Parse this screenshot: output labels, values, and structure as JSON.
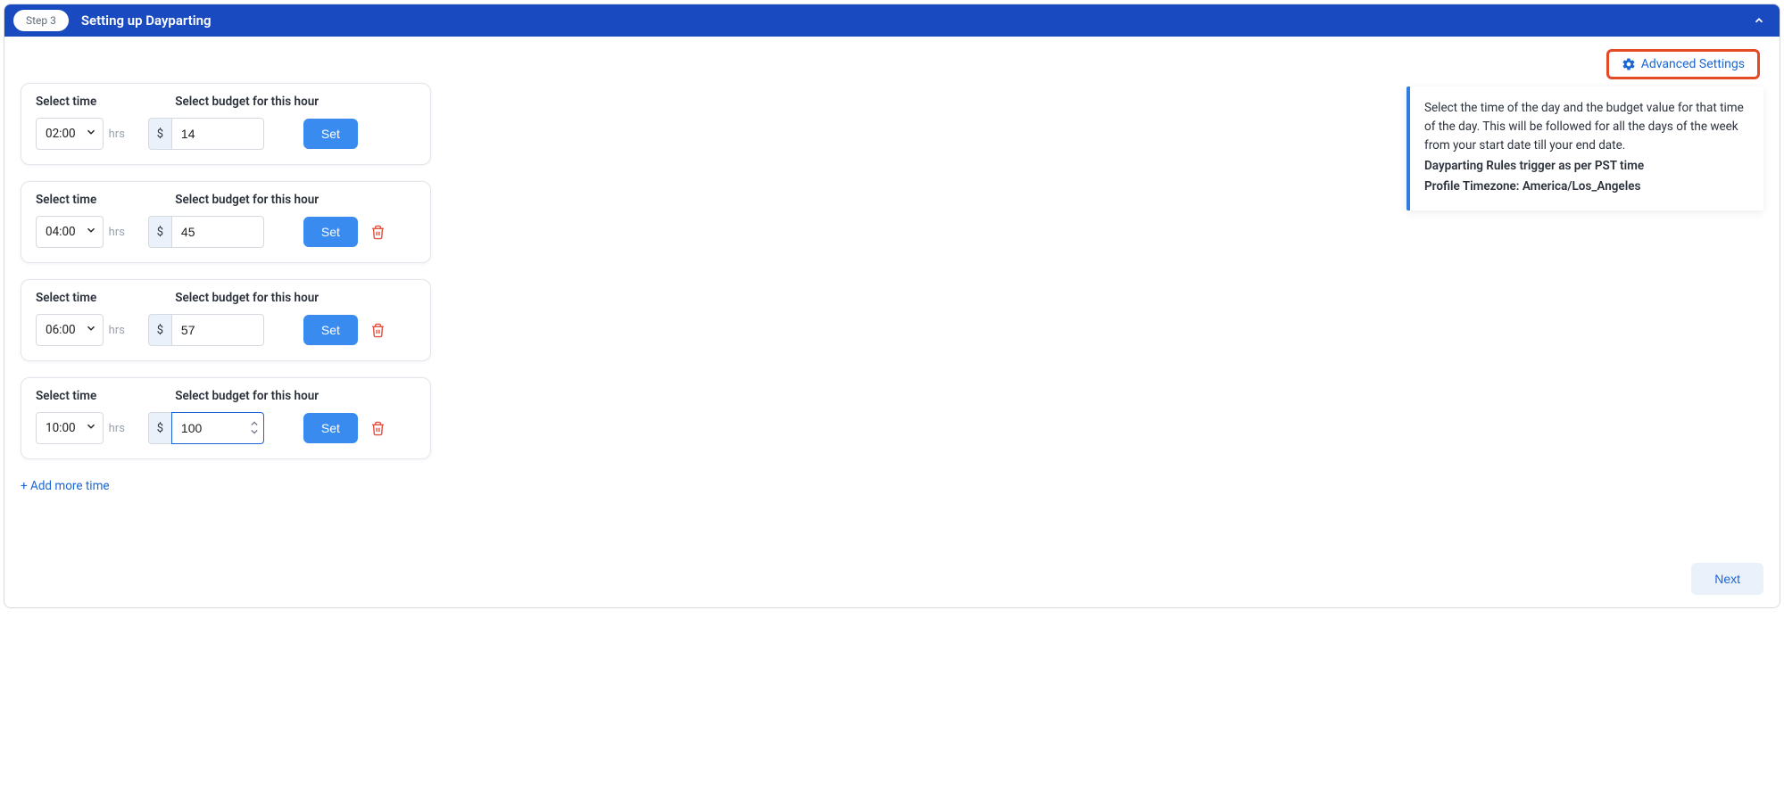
{
  "header": {
    "step_label": "Step 3",
    "title": "Setting up Dayparting"
  },
  "advanced_settings_label": "Advanced Settings",
  "labels": {
    "select_time": "Select time",
    "select_budget": "Select budget for this hour",
    "hrs": "hrs",
    "currency": "$",
    "set": "Set"
  },
  "rows": [
    {
      "time": "02:00",
      "budget": "14",
      "show_delete": false,
      "focused": false,
      "show_stepper": false
    },
    {
      "time": "04:00",
      "budget": "45",
      "show_delete": true,
      "focused": false,
      "show_stepper": false
    },
    {
      "time": "06:00",
      "budget": "57",
      "show_delete": true,
      "focused": false,
      "show_stepper": false
    },
    {
      "time": "10:00",
      "budget": "100",
      "show_delete": true,
      "focused": true,
      "show_stepper": true
    }
  ],
  "add_more_label": "+ Add more time",
  "info": {
    "text": "Select the time of the day and the budget value for that time of the day. This will be followed for all the days of the week from your start date till your end date.",
    "bold1": "Dayparting Rules trigger as per PST time",
    "bold2": "Profile Timezone: America/Los_Angeles"
  },
  "next_label": "Next"
}
